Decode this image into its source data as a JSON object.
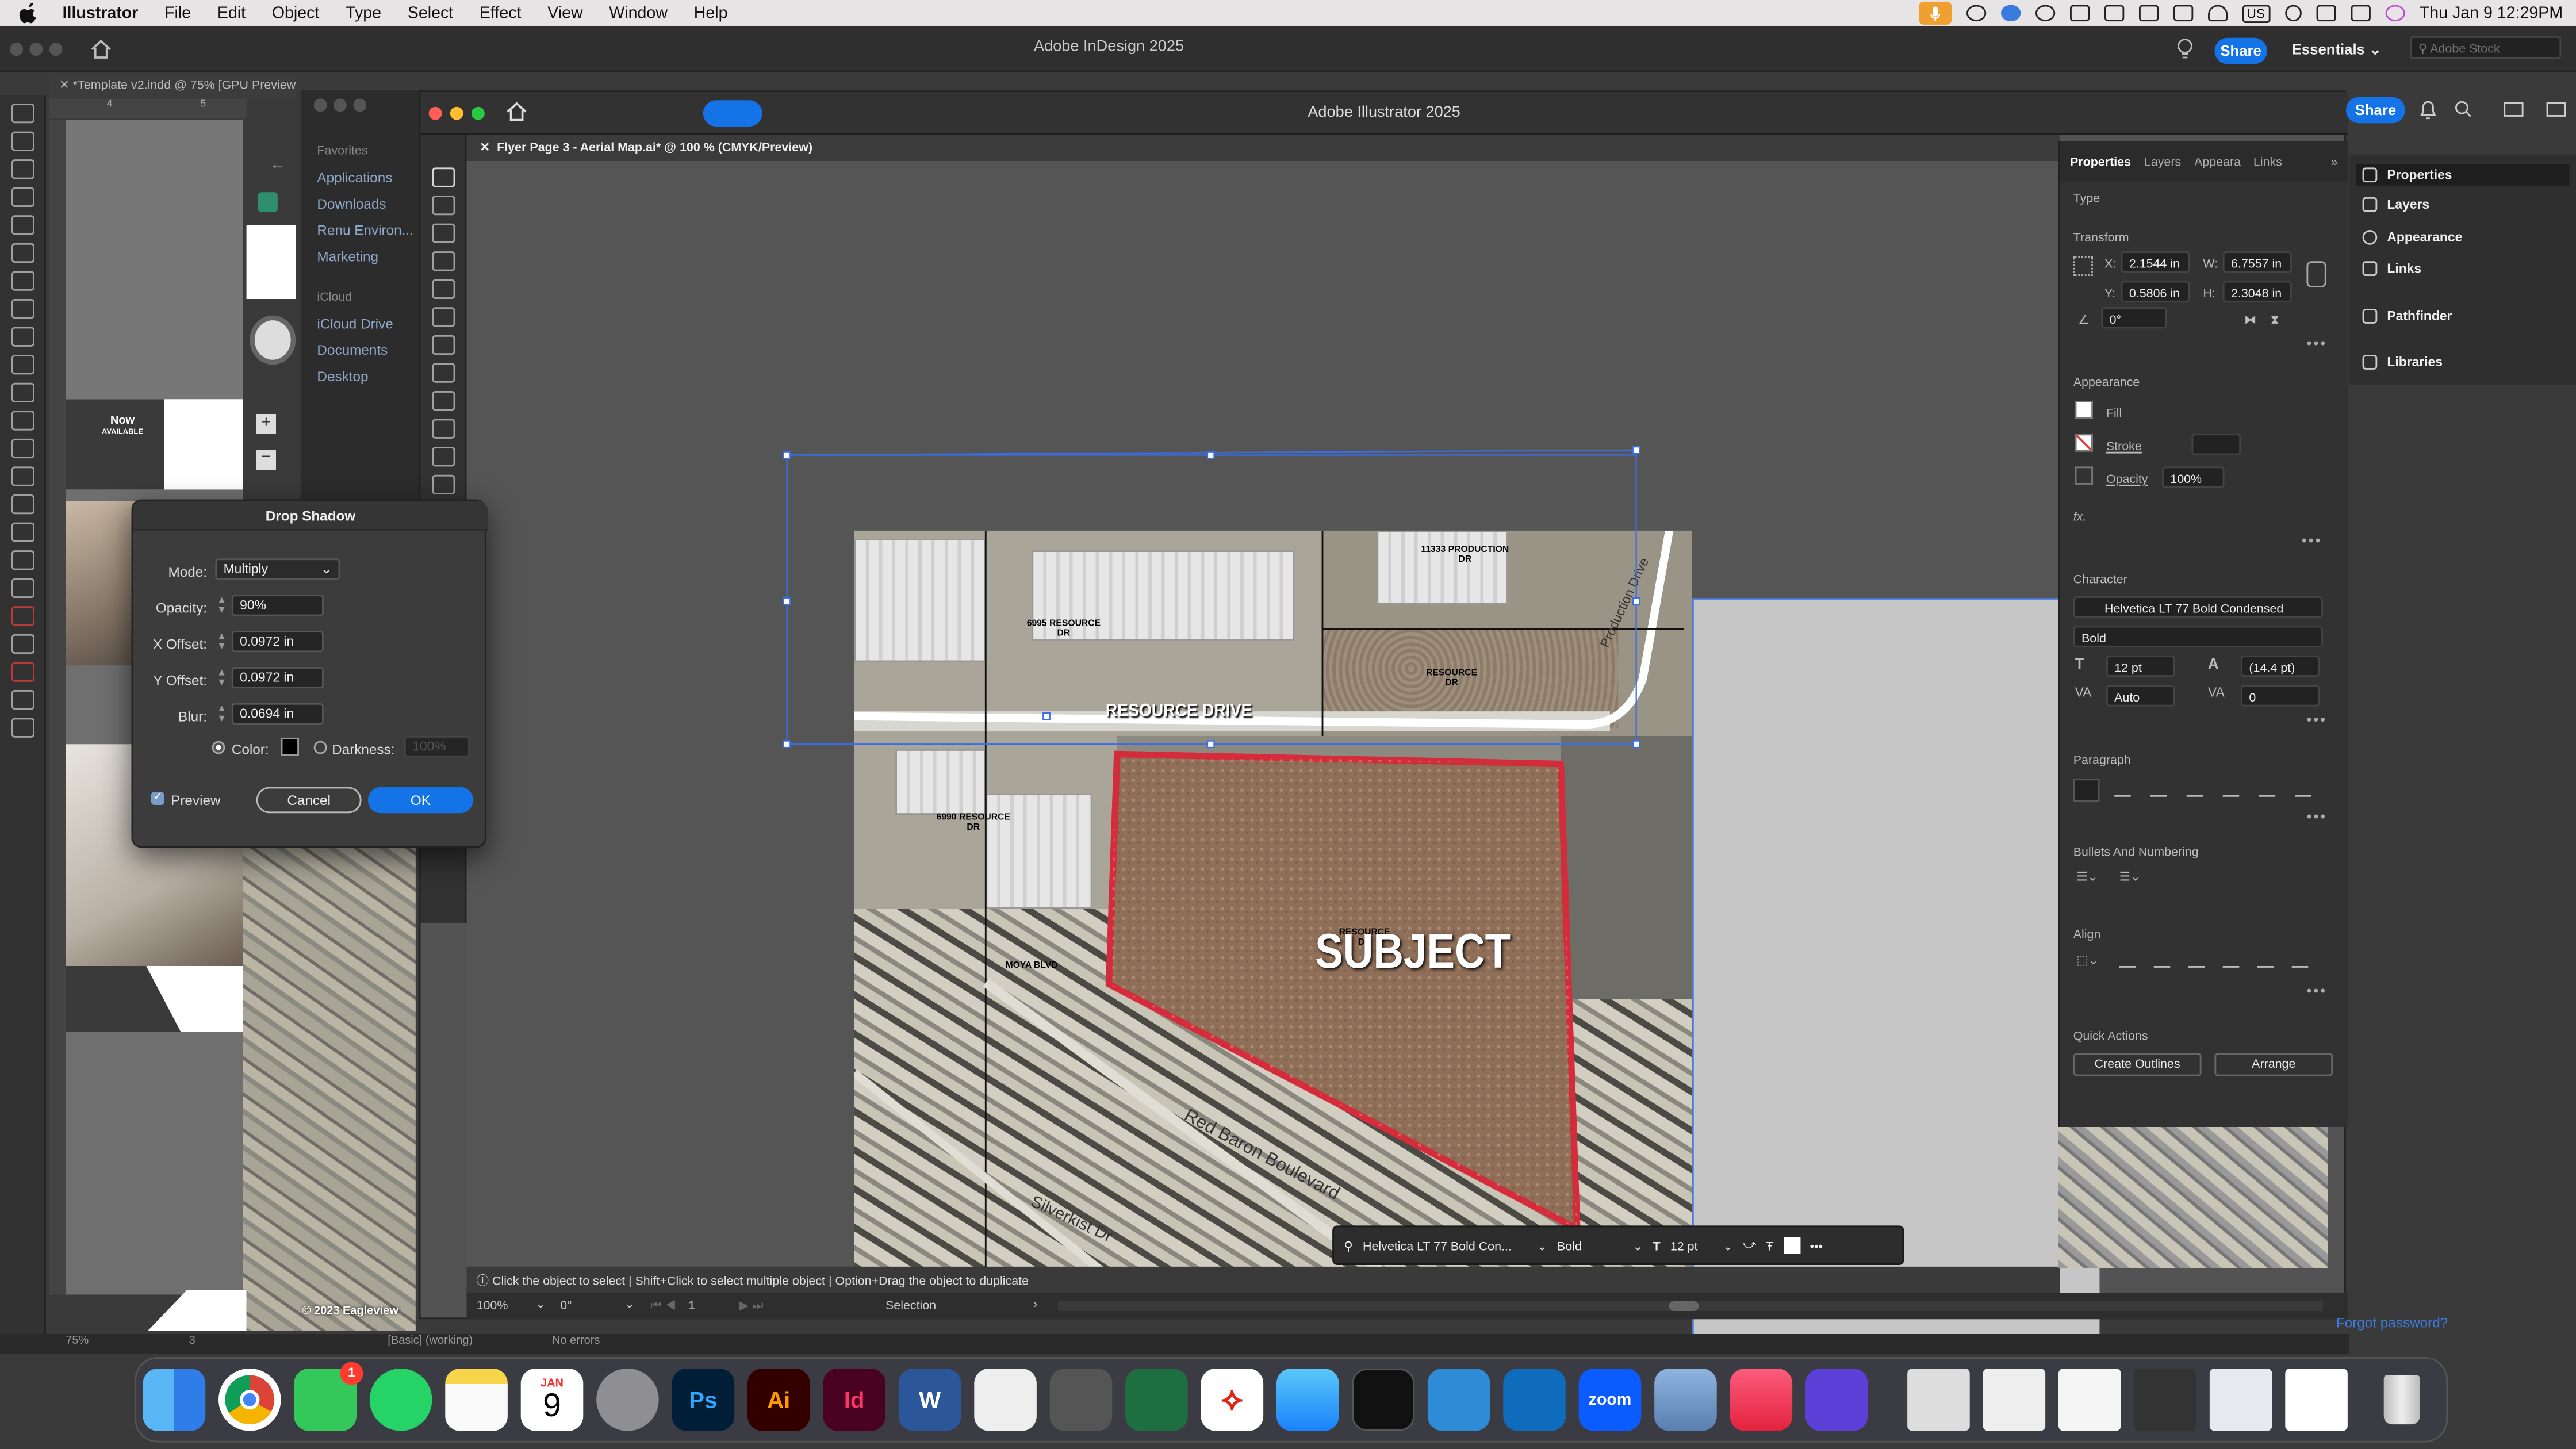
{
  "menubar": {
    "app_name": "Illustrator",
    "items": [
      "File",
      "Edit",
      "Object",
      "Type",
      "Select",
      "Effect",
      "View",
      "Window",
      "Help"
    ],
    "clock": "Thu Jan 9  12:29PM",
    "keyboard": "US"
  },
  "indesign": {
    "title": "Adobe InDesign 2025",
    "share": "Share",
    "workspace": "Essentials",
    "stock_placeholder": "Adobe Stock",
    "doc_tab": "*Template v2.indd @ 75% [GPU Preview]",
    "zoom": "75%",
    "page": "3",
    "preflight": "[Basic] (working)",
    "errors": "No errors",
    "ruler_marks": [
      "4",
      "5"
    ]
  },
  "finder": {
    "favorites": "Favorites",
    "fav_items": [
      "Applications",
      "Downloads",
      "Renu Environ...",
      "Marketing"
    ],
    "icloud": "iCloud",
    "icloud_items": [
      "iCloud Drive",
      "Documents",
      "Desktop"
    ]
  },
  "id_page": {
    "badge_line1": "Now",
    "badge_line2": "AVAILABLE",
    "copyright": "© 2023 Eagleview"
  },
  "illustrator": {
    "title": "Adobe Illustrator 2025",
    "share": "Share",
    "doc_tab": "Flyer Page 3 - Aerial Map.ai* @ 100 % (CMYK/Preview)",
    "status_text": "Click the object to select  |  Shift+Click to select multiple object  |  Option+Drag the object to duplicate",
    "zoom": "100%",
    "rotation": "0°",
    "artboard": "1",
    "tool_name": "Selection"
  },
  "map": {
    "subject": "SUBJECT",
    "resource_drive": "RESOURCE DRIVE",
    "labels": {
      "a": "6995 RESOURCE\nDR",
      "b": "11333 PRODUCTION\nDR",
      "c": "RESOURCE\nDR",
      "d": "6990 RESOURCE\nDR",
      "e": "RESOURCE\nDR",
      "f": "MOYA BLVD",
      "g": "Red Baron Boulevard",
      "h": "Silverkist Dr",
      "i": "Production Drive"
    }
  },
  "context_bar": {
    "font": "Helvetica LT 77 Bold Con...",
    "style": "Bold",
    "size": "12 pt"
  },
  "properties": {
    "tabs": [
      "Properties",
      "Layers",
      "Appearance",
      "Links"
    ],
    "type_label": "Type",
    "transform": {
      "title": "Transform",
      "x": "2.1544 in",
      "y": "0.5806 in",
      "w": "6.7557 in",
      "h": "2.3048 in",
      "angle": "0°"
    },
    "appearance": {
      "title": "Appearance",
      "fill": "Fill",
      "stroke": "Stroke",
      "opacity_label": "Opacity",
      "opacity": "100%"
    },
    "character": {
      "title": "Character",
      "font": "Helvetica LT 77 Bold Condensed",
      "style": "Bold",
      "size": "12 pt",
      "leading": "(14.4 pt)",
      "kerning": "Auto",
      "tracking": "0"
    },
    "paragraph": "Paragraph",
    "bullets": "Bullets And Numbering",
    "align": "Align",
    "quick_actions": "Quick Actions",
    "create_outlines": "Create Outlines",
    "arrange": "Arrange"
  },
  "dock_panel": {
    "items": [
      "Properties",
      "Layers",
      "Appearance",
      "Links",
      "Pathfinder",
      "Libraries"
    ]
  },
  "drop_shadow": {
    "title": "Drop Shadow",
    "mode_label": "Mode:",
    "mode": "Multiply",
    "opacity_label": "Opacity:",
    "opacity": "90%",
    "xoff_label": "X Offset:",
    "xoff": "0.0972 in",
    "yoff_label": "Y Offset:",
    "yoff": "0.0972 in",
    "blur_label": "Blur:",
    "blur": "0.0694 in",
    "color_label": "Color:",
    "darkness_label": "Darkness:",
    "darkness": "100%",
    "preview": "Preview",
    "cancel": "Cancel",
    "ok": "OK"
  },
  "dock": {
    "calendar_month": "JAN",
    "calendar_day": "9",
    "messages_badge": "1",
    "apps": [
      "Ps",
      "Ai",
      "Id",
      "W",
      "zoom"
    ]
  },
  "login": {
    "forgot": "Forgot password?"
  }
}
